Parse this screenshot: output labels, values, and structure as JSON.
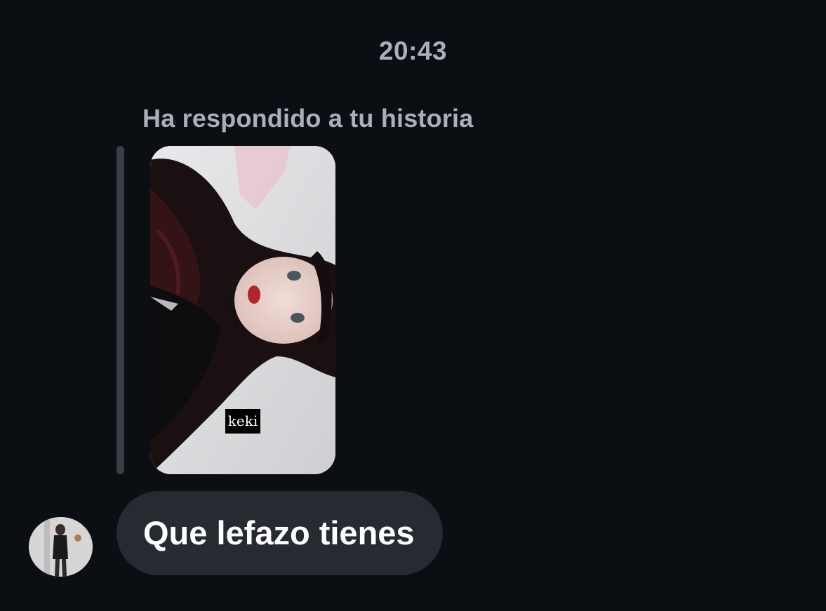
{
  "chat": {
    "timestamp": "20:43",
    "reply_note": "Ha respondido a tu historia",
    "story_reply": {
      "sticker_text": "keki"
    },
    "message": {
      "text": "Que lefazo tienes"
    }
  },
  "colors": {
    "background": "#0b0e13",
    "secondary_text": "#a9b0bc",
    "bubble": "#262a31",
    "reply_bar": "#3a3e45",
    "message_text": "#ffffff"
  }
}
